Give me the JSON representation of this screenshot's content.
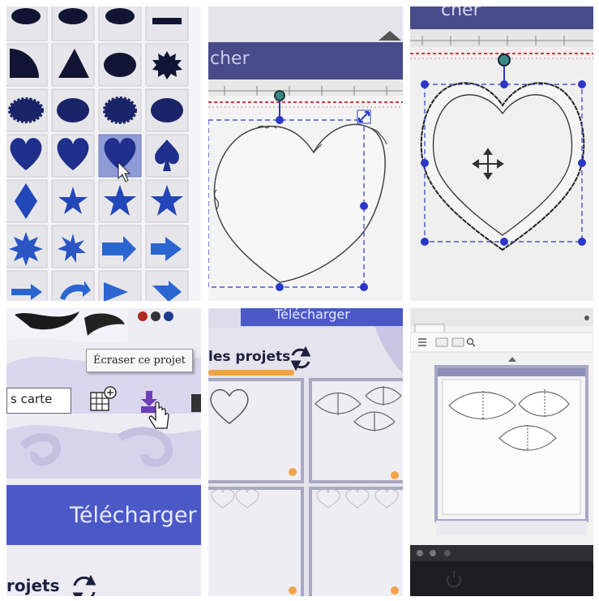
{
  "panel_top_middle": {
    "ribbon_title": "cher"
  },
  "panel_top_right": {
    "ribbon_title": "cher"
  },
  "panel_bottom_left": {
    "tooltip": "Écraser ce projet",
    "search_value": "s carte",
    "upload_button_label": "Télécharger",
    "section_title": "rojets"
  },
  "panel_bottom_middle": {
    "upload_button_label": "Télécharger",
    "section_title": "les projets"
  },
  "colors": {
    "shape_fill": "#1e2f8c",
    "selected_tile": "#8f9bd6",
    "primary_button": "#4b59c7",
    "handle": "#2a37c7",
    "rotate_handle": "#3a8a86",
    "progress": "#f2a24b"
  },
  "icons": [
    "cursor-icon",
    "rotate-handle-icon",
    "move-icon",
    "resize-handle-icon",
    "grid-add-icon",
    "save-download-icon",
    "hand-cursor-icon",
    "refresh-icon",
    "upload-icon",
    "search-icon",
    "power-icon"
  ]
}
